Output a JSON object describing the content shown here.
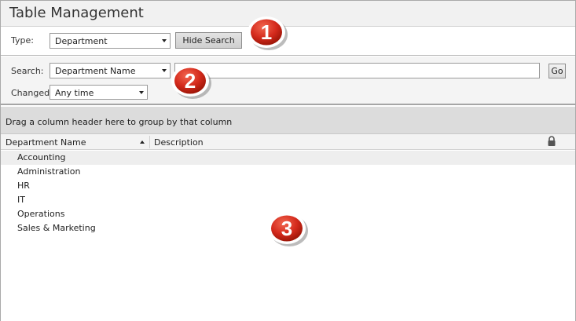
{
  "title": "Table Management",
  "type_filter": {
    "label": "Type:",
    "selected": "Department",
    "hide_search_label": "Hide Search"
  },
  "search": {
    "label": "Search:",
    "field_selected": "Department Name",
    "value": "",
    "go_label": "Go",
    "changed_label": "Changed:",
    "changed_selected": "Any time"
  },
  "grid": {
    "group_hint": "Drag a column header here to group by that column",
    "columns": [
      {
        "label": "Department Name",
        "sorted": "ascending"
      },
      {
        "label": "Description"
      }
    ],
    "rows": [
      {
        "name": "Accounting",
        "selected": true
      },
      {
        "name": "Administration"
      },
      {
        "name": "HR"
      },
      {
        "name": "IT"
      },
      {
        "name": "Operations"
      },
      {
        "name": "Sales & Marketing"
      }
    ]
  },
  "callouts": [
    "1",
    "2",
    "3"
  ],
  "icons": {
    "lock": "lock-icon",
    "sort": "sort-ascending-icon",
    "dropdown": "chevron-down-icon"
  },
  "colors": {
    "callout_red": "#d42a1c",
    "selected_row": "#eeeeee",
    "group_panel": "#dcdcdc"
  }
}
